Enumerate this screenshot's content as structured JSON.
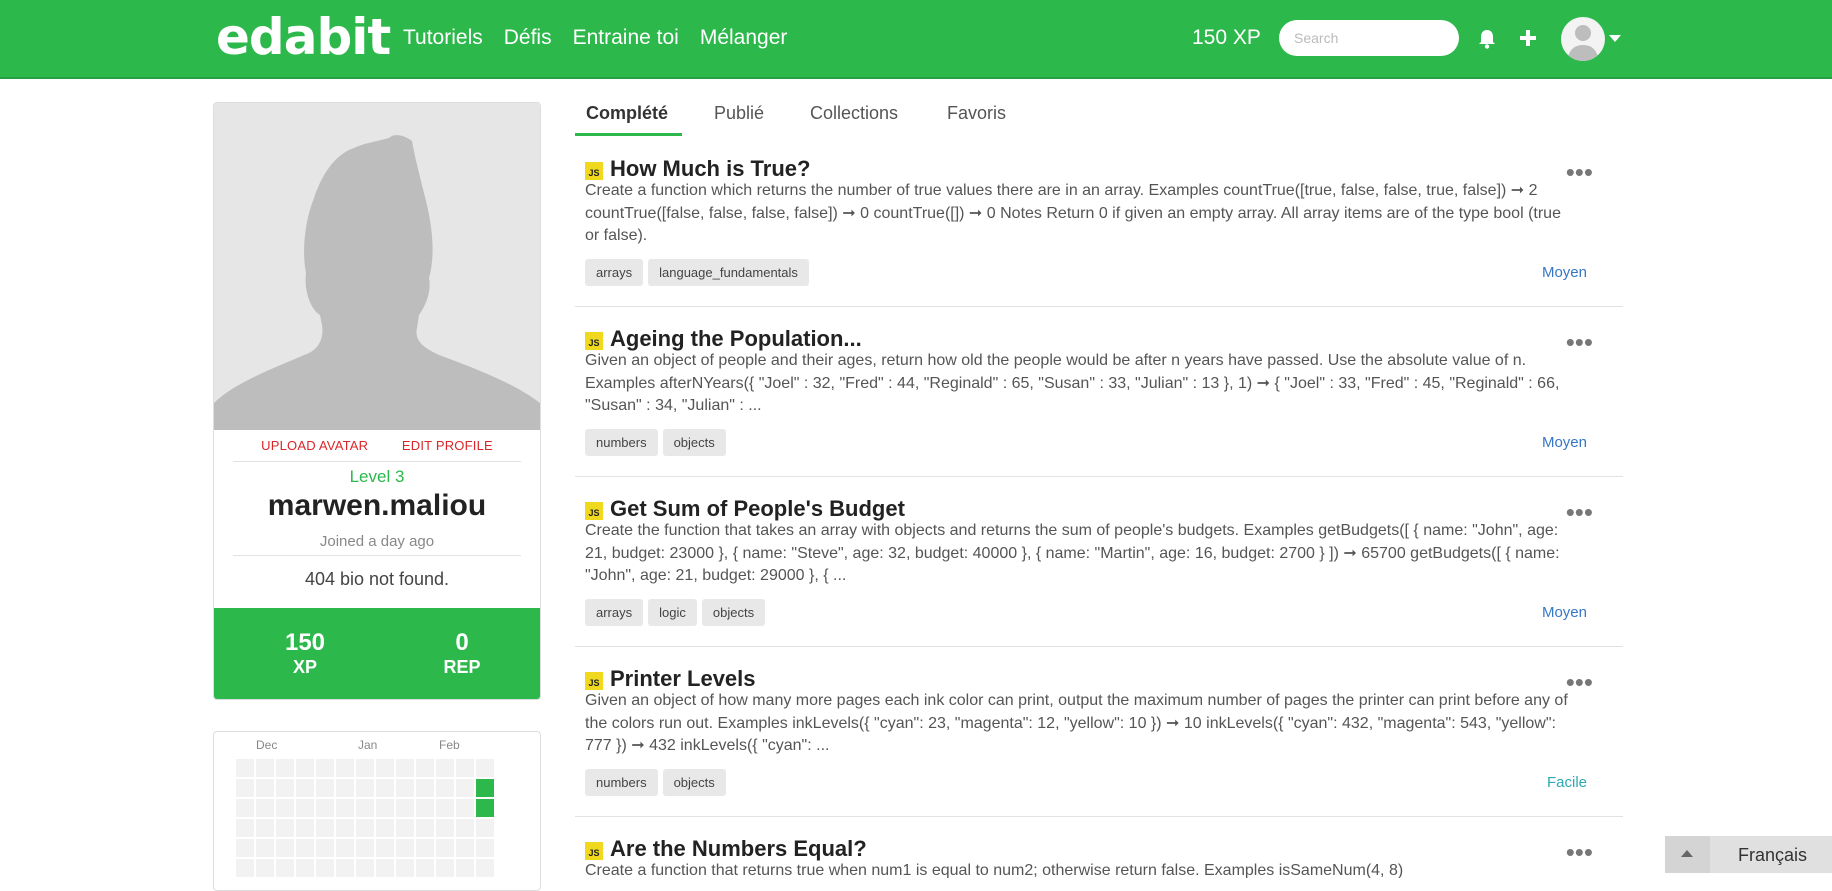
{
  "header": {
    "logo": "edabit",
    "nav": [
      "Tutoriels",
      "Défis",
      "Entraine toi",
      "Mélanger"
    ],
    "xp": "150 XP",
    "search_placeholder": "Search",
    "icons": [
      "bell-icon",
      "plus-icon",
      "user-avatar-icon",
      "caret-down-icon"
    ]
  },
  "profile": {
    "upload_avatar": "UPLOAD AVATAR",
    "edit_profile": "EDIT PROFILE",
    "level": "Level 3",
    "username": "marwen.maliou",
    "joined": "Joined a day ago",
    "bio": "404 bio not found.",
    "stats": [
      {
        "value": "150",
        "label": "XP"
      },
      {
        "value": "0",
        "label": "REP"
      }
    ]
  },
  "activity": {
    "months": [
      "Dec",
      "Jan",
      "Feb"
    ],
    "active_color": "#2db84c",
    "empty_color": "#f2f2f2"
  },
  "tabs": [
    "Complété",
    "Publié",
    "Collections",
    "Favoris"
  ],
  "challenges": [
    {
      "title": "How Much is True?",
      "description": "Create a function which returns the number of true values there are in an array. Examples countTrue([true, false, false, true, false]) ➞ 2 countTrue([false, false, false, false]) ➞ 0 countTrue([]) ➞ 0 Notes Return 0 if given an empty array. All array items are of the type bool (true or false).",
      "tags": [
        "arrays",
        "language_fundamentals"
      ],
      "difficulty": "Moyen"
    },
    {
      "title": "Ageing the Population...",
      "description": "Given an object of people and their ages, return how old the people would be after n years have passed. Use the absolute value of n. Examples afterNYears({ \"Joel\" : 32, \"Fred\" : 44, \"Reginald\" : 65, \"Susan\" : 33, \"Julian\" : 13 }, 1) ➞ { \"Joel\" : 33, \"Fred\" : 45, \"Reginald\" : 66, \"Susan\" : 34, \"Julian\" : ...",
      "tags": [
        "numbers",
        "objects"
      ],
      "difficulty": "Moyen"
    },
    {
      "title": "Get Sum of People's Budget",
      "description": "Create the function that takes an array with objects and returns the sum of people's budgets. Examples getBudgets([ { name: \"John\", age: 21, budget: 23000 }, { name: \"Steve\", age: 32, budget: 40000 }, { name: \"Martin\", age: 16, budget: 2700 } ]) ➞ 65700 getBudgets([ { name: \"John\", age: 21, budget: 29000 }, { ...",
      "tags": [
        "arrays",
        "logic",
        "objects"
      ],
      "difficulty": "Moyen"
    },
    {
      "title": "Printer Levels",
      "description": "Given an object of how many more pages each ink color can print, output the maximum number of pages the printer can print before any of the colors run out. Examples inkLevels({ \"cyan\": 23, \"magenta\": 12, \"yellow\": 10 }) ➞ 10 inkLevels({ \"cyan\": 432, \"magenta\": 543, \"yellow\": 777 }) ➞ 432 inkLevels({ \"cyan\": ...",
      "tags": [
        "numbers",
        "objects"
      ],
      "difficulty": "Facile"
    },
    {
      "title": "Are the Numbers Equal?",
      "description": "Create a function that returns true when num1 is equal to num2; otherwise return false. Examples isSameNum(4, 8)",
      "tags": [],
      "difficulty": ""
    }
  ],
  "language": "Français"
}
